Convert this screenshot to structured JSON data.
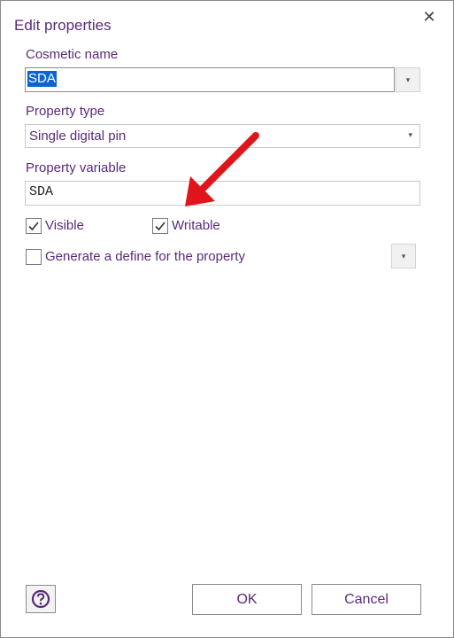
{
  "dialog": {
    "title": "Edit properties",
    "close_glyph": "✕"
  },
  "cosmetic_name": {
    "label": "Cosmetic name",
    "value": "SDA",
    "dropdown_glyph": "▾"
  },
  "property_type": {
    "label": "Property type",
    "value": "Single digital pin",
    "dropdown_glyph": "▾"
  },
  "property_variable": {
    "label": "Property variable",
    "value": "SDA"
  },
  "visible": {
    "label": "Visible",
    "checked": true
  },
  "writable": {
    "label": "Writable",
    "checked": true
  },
  "generate_define": {
    "label": "Generate a define for the property",
    "checked": false,
    "dropdown_glyph": "▾"
  },
  "footer": {
    "help_icon": "question-circle-icon",
    "ok_label": "OK",
    "cancel_label": "Cancel"
  },
  "annotation": {
    "arrow_color": "#e0151b",
    "points_to": "writable-checkbox"
  },
  "colors": {
    "accent_text": "#5a2a7a",
    "selection": "#0a64d2"
  }
}
